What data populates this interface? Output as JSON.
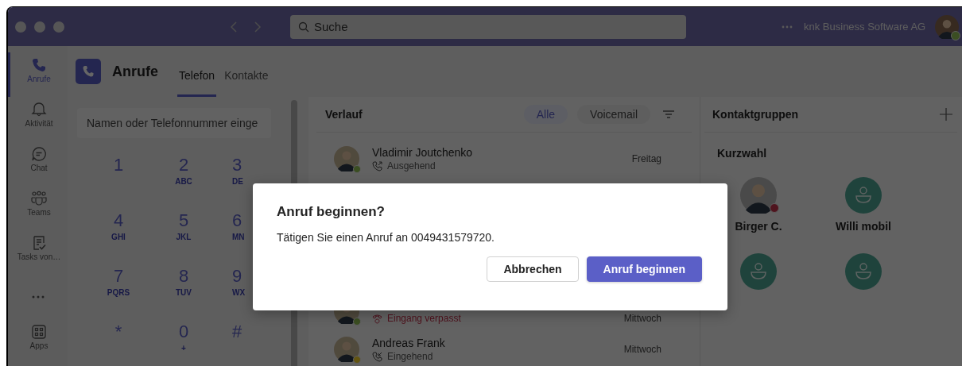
{
  "title_bar": {
    "search": {
      "placeholder": "Suche"
    },
    "organization": "knk Business Software AG",
    "user_presence": {
      "color": "#3b4e22"
    }
  },
  "sidebar": {
    "items": [
      {
        "label": "Anrufe",
        "selected": true
      },
      {
        "label": "Aktivität",
        "selected": false
      },
      {
        "label": "Chat",
        "selected": false
      },
      {
        "label": "Teams",
        "selected": false
      },
      {
        "label": "Tasks von…",
        "selected": false
      }
    ],
    "bottom_items": [
      {
        "label": "Apps",
        "selected": false
      }
    ]
  },
  "header": {
    "title": "Anrufe",
    "tabs": [
      {
        "label": "Telefon",
        "selected": true
      },
      {
        "label": "Kontakte",
        "selected": false
      }
    ]
  },
  "dialpad": {
    "input": {
      "placeholder": "Namen oder Telefonnummer einge"
    },
    "keys": [
      {
        "digit": "1"
      },
      {
        "digit": "2",
        "letters": "ABC"
      },
      {
        "digit": "3",
        "letters": "DE"
      },
      {
        "digit": "4",
        "letters": "GHI"
      },
      {
        "digit": "5",
        "letters": "JKL"
      },
      {
        "digit": "6",
        "letters": "MN"
      },
      {
        "digit": "7",
        "letters": "PQRS"
      },
      {
        "digit": "8",
        "letters": "TUV"
      },
      {
        "digit": "9",
        "letters": "WX"
      },
      {
        "digit": "*"
      },
      {
        "digit": "0",
        "letters": "+"
      },
      {
        "digit": "#"
      }
    ]
  },
  "history": {
    "title": "Verlauf",
    "filters": [
      {
        "label": "Alle",
        "selected": true
      },
      {
        "label": "Voicemail",
        "selected": false
      }
    ],
    "entries": [
      {
        "name": "Vladimir Joutchenko",
        "kind": "outgoing",
        "status": "Ausgehend",
        "time": "Freitag",
        "color": "#3b4e22"
      },
      {
        "kind": "missed",
        "status": "Eingang verpasst",
        "time": "Mittwoch",
        "color": "#3b4e22"
      },
      {
        "name": "Andreas Frank",
        "kind": "incoming",
        "status": "Eingehend",
        "time": "Mittwoch",
        "color": "#635411"
      }
    ]
  },
  "contact_groups": {
    "title": "Kontaktgruppen",
    "speed_dial": {
      "title": "Kurzwahl",
      "contacts": [
        {
          "name": "Birger C.",
          "kind": "photo",
          "color": "#4f141e"
        },
        {
          "name": "Willi mobil",
          "kind": "placeholder"
        },
        {
          "kind": "placeholder"
        },
        {
          "kind": "placeholder"
        }
      ]
    }
  },
  "dialog": {
    "title": "Anruf beginnen?",
    "message": "Tätigen Sie einen Anruf an 0049431579720.",
    "buttons": [
      {
        "label": "Abbrechen",
        "primary": false
      },
      {
        "label": "Anruf beginnen",
        "primary": true
      }
    ]
  }
}
